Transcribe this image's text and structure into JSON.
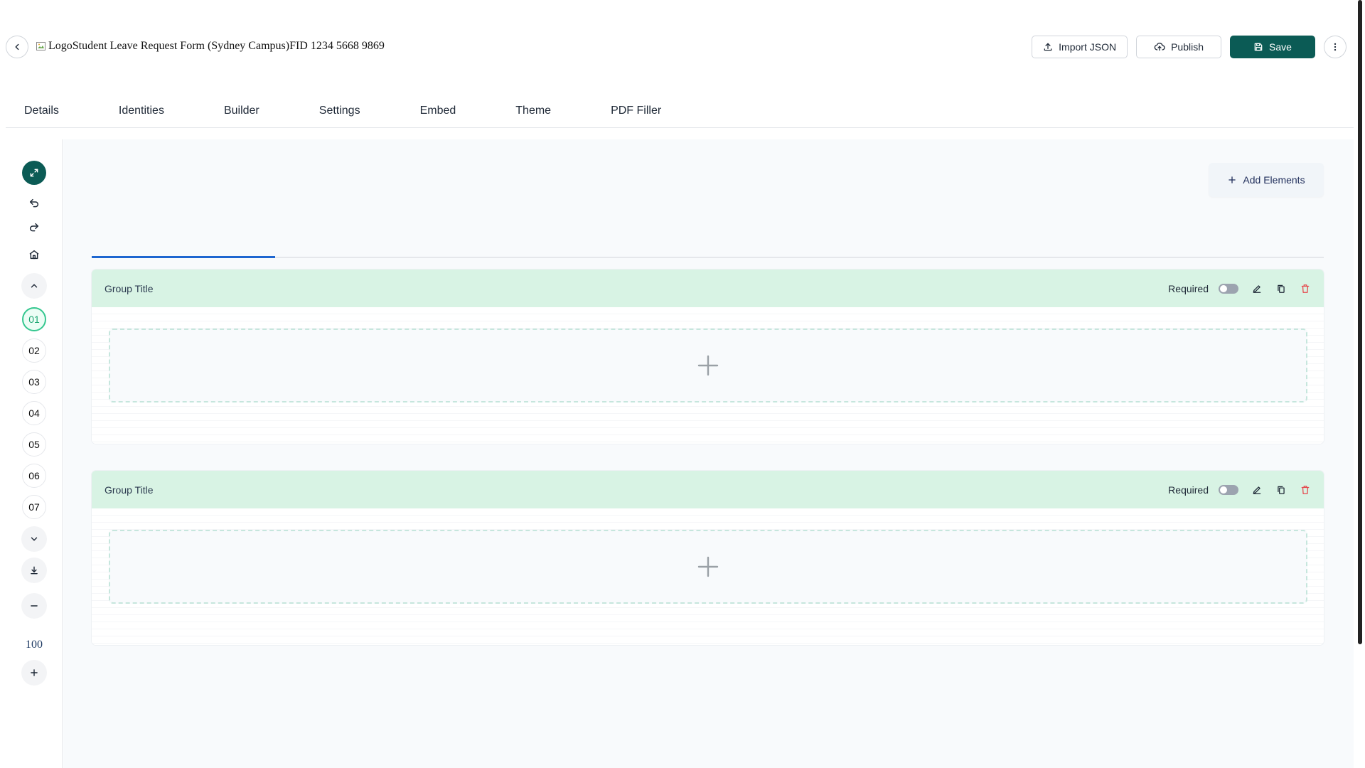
{
  "header": {
    "logo_alt": "Logo",
    "form_title": "Student Leave Request Form (Sydney Campus)",
    "form_id": "FID 1234 5668 9869",
    "import_label": "Import JSON",
    "publish_label": "Publish",
    "save_label": "Save"
  },
  "tabs": [
    {
      "label": "Details"
    },
    {
      "label": "Identities"
    },
    {
      "label": "Builder"
    },
    {
      "label": "Settings"
    },
    {
      "label": "Embed"
    },
    {
      "label": "Theme"
    },
    {
      "label": "PDF Filler"
    }
  ],
  "rail": {
    "steps": [
      "01",
      "02",
      "03",
      "04",
      "05",
      "06",
      "07"
    ],
    "active_step": "01",
    "zoom_value": "100"
  },
  "canvas": {
    "add_elements_label": "Add Elements",
    "groups": [
      {
        "title": "Group Title",
        "required_label": "Required"
      },
      {
        "title": "Group Title",
        "required_label": "Required"
      }
    ]
  },
  "colors": {
    "primary": "#0b5b55",
    "group_header": "#d8f3e4",
    "active_tab_underline": "#1e66d0",
    "delete": "#e5484d",
    "active_step": "#34c78f"
  },
  "icons": {
    "back": "chevron-left-icon",
    "import": "upload-icon",
    "publish": "cloud-upload-icon",
    "save": "floppy-disk-icon",
    "more": "more-vertical-icon"
  }
}
